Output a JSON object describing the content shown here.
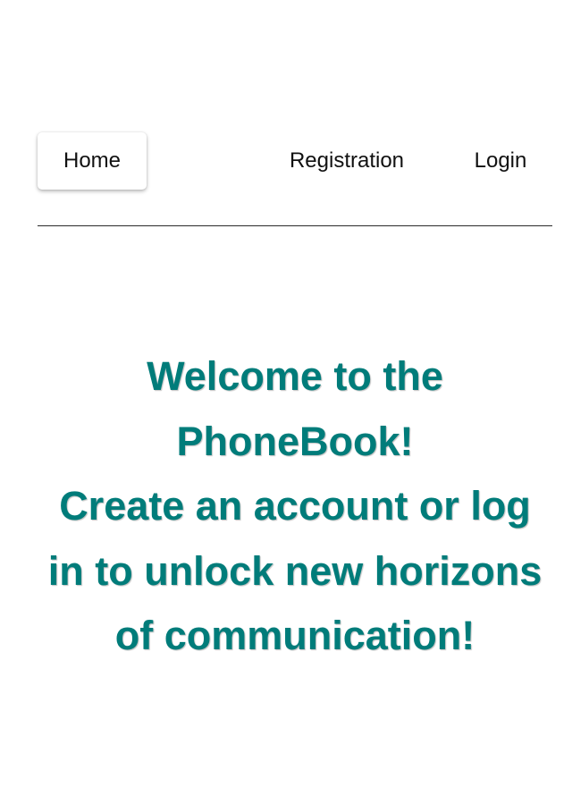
{
  "nav": {
    "home_label": "Home",
    "registration_label": "Registration",
    "login_label": "Login"
  },
  "hero": {
    "welcome_text": "Welcome to the PhoneBook!",
    "cta_text": "Create an account or log in to unlock new horizons of communication!"
  },
  "colors": {
    "accent": "#007c7a",
    "text": "#111111",
    "background": "#ffffff",
    "divider": "#2b2b2b"
  }
}
